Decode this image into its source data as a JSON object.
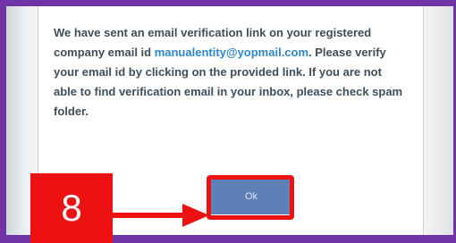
{
  "dialog": {
    "message_part1": "We have sent an email verification link on your registered company email id ",
    "email": "manualentity@yopmail.com",
    "message_part2": ". Please verify your email id by clicking on the provided link. If you are not able to find verification email in your inbox, please check spam folder.",
    "ok_label": "Ok"
  },
  "annotation": {
    "step_number": "8",
    "color": "#ee1111"
  },
  "colors": {
    "border_accent": "#6f33a6",
    "button": "#5f7fb6",
    "link": "#2e86c8",
    "text": "#3f4e5a"
  }
}
